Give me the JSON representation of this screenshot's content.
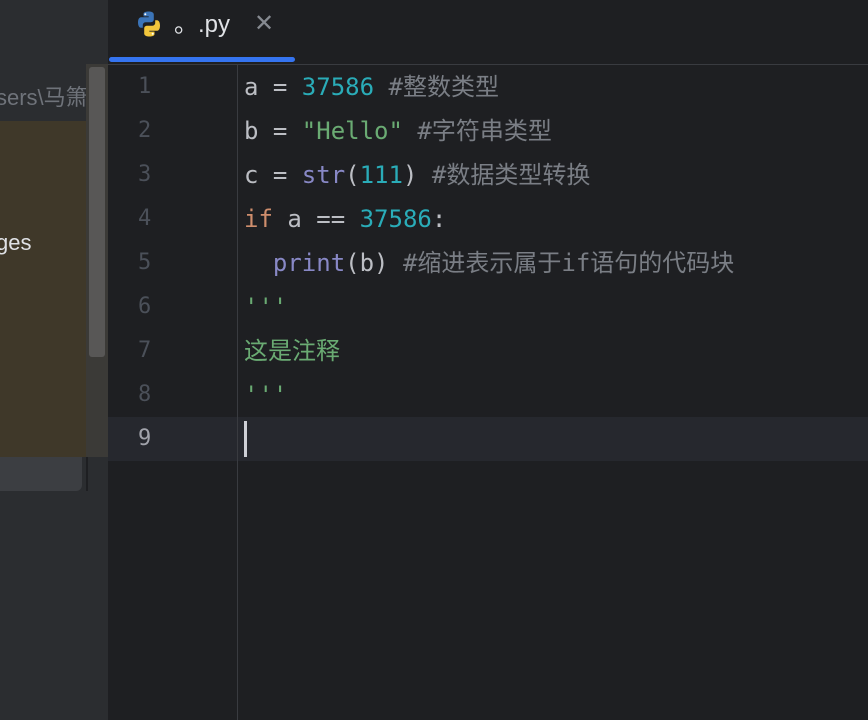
{
  "left_panel": {
    "path_fragment": "sers\\马箫",
    "dialog_label_fragment": "ges"
  },
  "tab": {
    "filename": "。.py",
    "icon": "python-icon",
    "close_icon": "close-icon"
  },
  "editor": {
    "line_numbers": [
      "1",
      "2",
      "3",
      "4",
      "5",
      "6",
      "7",
      "8",
      "9"
    ],
    "active_line": "9",
    "lines": [
      {
        "t1": "a = ",
        "num": "37586",
        "t2": " ",
        "cmt": "#整数类型"
      },
      {
        "t1": "b = ",
        "str": "\"Hello\"",
        "t2": " ",
        "cmt": "#字符串类型"
      },
      {
        "t1": "c = ",
        "bi": "str",
        "p1": "(",
        "num": "111",
        "p2": ")",
        "t2": " ",
        "cmt": "#数据类型转换"
      },
      {
        "kw": "if",
        "t1": " a == ",
        "num": "37586",
        "t2": ":"
      },
      {
        "indent": "  ",
        "bi": "print",
        "t1": "(b) ",
        "cmt": "#缩进表示属于if语句的代码块"
      },
      {
        "str": "'''"
      },
      {
        "str": "这是注释"
      },
      {
        "str": "'''"
      },
      {}
    ]
  },
  "colors": {
    "number": "#2aacb8",
    "string": "#6aab73",
    "comment": "#7a7e85",
    "keyword": "#cf8e6d",
    "builtin": "#8888c6",
    "accent": "#3574f0"
  }
}
